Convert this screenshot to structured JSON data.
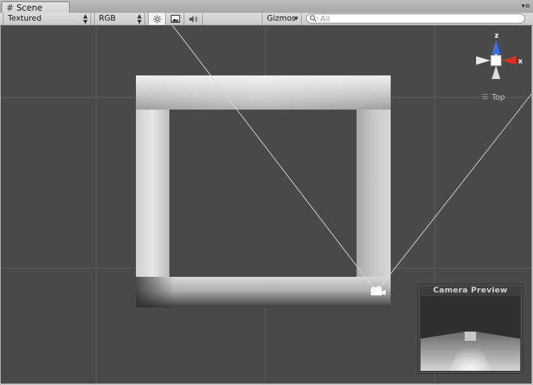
{
  "tab": {
    "title": "Scene",
    "icon": "grid-icon"
  },
  "toolbar": {
    "render_mode": "Textured",
    "color_mode": "RGB",
    "buttons": [
      "lighting-toggle",
      "scene-fx-toggle",
      "audio-toggle"
    ],
    "gizmos_label": "Gizmos",
    "search_placeholder": "All"
  },
  "viewport": {
    "view_orientation": "Top",
    "gizmo_axes": {
      "z": "z",
      "x": "x"
    },
    "colors": {
      "background": "#494949",
      "x_axis": "#d8301c",
      "z_axis": "#3a6fe8"
    }
  },
  "camera_preview": {
    "title": "Camera Preview"
  }
}
